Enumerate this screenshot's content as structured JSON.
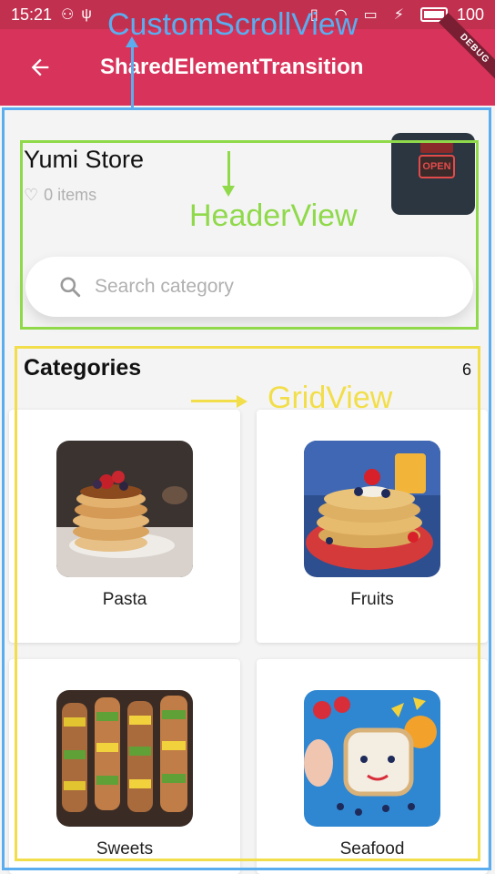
{
  "status_bar": {
    "time": "15:21",
    "battery": "100",
    "debug_banner": "DEBUG"
  },
  "appbar": {
    "title": "SharedElementTransition",
    "back_icon": "arrow-back-icon"
  },
  "header": {
    "store_name": "Yumi Store",
    "items_count": "0 items",
    "search_placeholder": "Search category"
  },
  "categories": {
    "title": "Categories",
    "count": "6",
    "items": [
      {
        "label": "Pasta",
        "image": "pancakes"
      },
      {
        "label": "Fruits",
        "image": "waffles"
      },
      {
        "label": "Sweets",
        "image": "kebabs"
      },
      {
        "label": "Seafood",
        "image": "toast-face"
      }
    ]
  },
  "annotations": {
    "custom_scroll_view": "CustomScrollView",
    "header_view": "HeaderView",
    "grid_view": "GridView",
    "colors": {
      "blue": "#5aaef0",
      "green": "#8fd94a",
      "yellow": "#f2de4a"
    }
  }
}
